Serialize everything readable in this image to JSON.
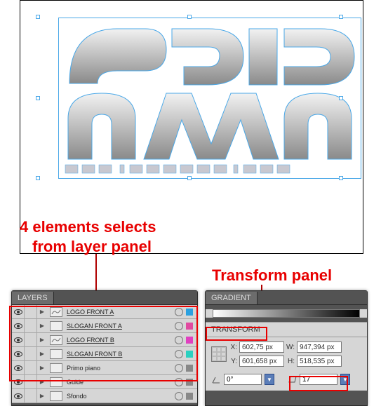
{
  "caption_main_line1": "4 elements selects",
  "caption_main_line2": "from layer panel",
  "caption_transform": "Transform panel",
  "layers_panel": {
    "title": "LAYERS",
    "rows": [
      {
        "name": "LOGO FRONT A",
        "chip": "#2aa0e0",
        "selected": true
      },
      {
        "name": "SLOGAN FRONT A",
        "chip": "#e04aa0",
        "selected": true
      },
      {
        "name": "LOGO FRONT B",
        "chip": "#e040c0",
        "selected": true
      },
      {
        "name": "SLOGAN FRONT B",
        "chip": "#2ad0c0",
        "selected": true
      },
      {
        "name": "Primo piano",
        "chip": "#888888",
        "selected": false
      },
      {
        "name": "Guide",
        "chip": "#888888",
        "selected": false
      },
      {
        "name": "Sfondo",
        "chip": "#888888",
        "selected": false
      }
    ]
  },
  "gradient_panel": {
    "title": "GRADIENT"
  },
  "transform_panel": {
    "title": "TRANSFORM",
    "x_label": "X:",
    "x": "602,75 px",
    "y_label": "Y:",
    "y": "601,658 px",
    "w_label": "W:",
    "w": "947,394 px",
    "h_label": "H:",
    "h": "518,535 px",
    "angle": "0°",
    "shear": "17"
  }
}
